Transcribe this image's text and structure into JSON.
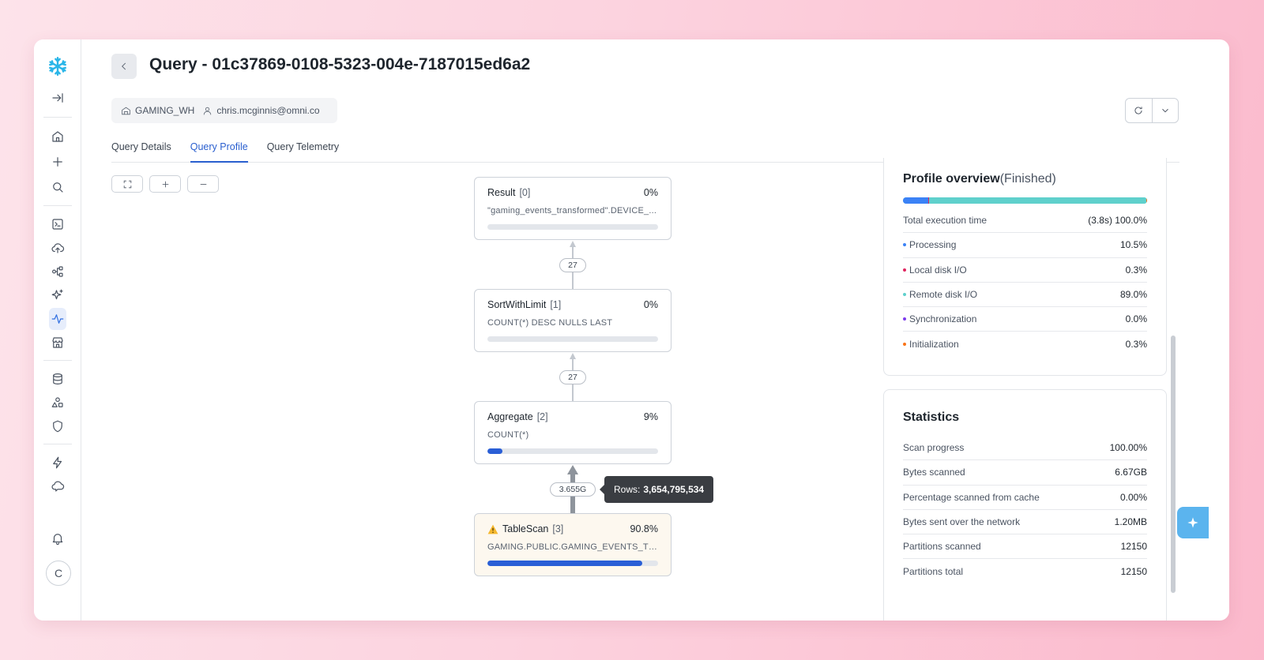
{
  "header": {
    "title": "Query - 01c37869-0108-5323-004e-7187015ed6a2",
    "warehouse": "GAMING_WH",
    "user": "chris.mcginnis@omni.co"
  },
  "tabs": [
    {
      "label": "Query Details",
      "active": false
    },
    {
      "label": "Query Profile",
      "active": true
    },
    {
      "label": "Query Telemetry",
      "active": false
    }
  ],
  "graph": {
    "nodes": [
      {
        "name": "Result",
        "index": "[0]",
        "percent": "0%",
        "detail": "\"gaming_events_transformed\".DEVICE_...",
        "bar_fraction": 0
      },
      {
        "name": "SortWithLimit",
        "index": "[1]",
        "percent": "0%",
        "detail": "COUNT(*) DESC NULLS LAST",
        "bar_fraction": 0
      },
      {
        "name": "Aggregate",
        "index": "[2]",
        "percent": "9%",
        "detail": "COUNT(*)",
        "bar_fraction": 0.09
      },
      {
        "name": "TableScan",
        "index": "[3]",
        "percent": "90.8%",
        "detail": "GAMING.PUBLIC.GAMING_EVENTS_TRA...",
        "bar_fraction": 0.908
      }
    ],
    "edges": [
      "27",
      "27",
      "3.655G"
    ],
    "tooltip": {
      "label": "Rows:",
      "value": "3,654,795,534"
    }
  },
  "profile_overview": {
    "title": "Profile overview",
    "status": "(Finished)",
    "total_label": "Total execution time",
    "total_value": "(3.8s) 100.0%",
    "items": [
      {
        "label": "Processing",
        "value": "10.5%",
        "color": "#3b82f6",
        "fraction": 0.105
      },
      {
        "label": "Local disk I/O",
        "value": "0.3%",
        "color": "#e0245e",
        "fraction": 0.003
      },
      {
        "label": "Remote disk I/O",
        "value": "89.0%",
        "color": "#5fd0cc",
        "fraction": 0.89
      },
      {
        "label": "Synchronization",
        "value": "0.0%",
        "color": "#7c3aed",
        "fraction": 0.0
      },
      {
        "label": "Initialization",
        "value": "0.3%",
        "color": "#f97316",
        "fraction": 0.003
      }
    ]
  },
  "statistics": {
    "title": "Statistics",
    "items": [
      {
        "label": "Scan progress",
        "value": "100.00%"
      },
      {
        "label": "Bytes scanned",
        "value": "6.67GB"
      },
      {
        "label": "Percentage scanned from cache",
        "value": "0.00%"
      },
      {
        "label": "Bytes sent over the network",
        "value": "1.20MB"
      },
      {
        "label": "Partitions scanned",
        "value": "12150"
      },
      {
        "label": "Partitions total",
        "value": "12150"
      }
    ]
  },
  "user_initial": "C",
  "icons": {
    "sidebar": [
      "snowflake-logo",
      "collapse-sidebar-icon",
      "home-icon",
      "plus-icon",
      "search-icon",
      "terminal-icon",
      "cloud-upload-icon",
      "data-flow-icon",
      "sparkles-icon",
      "activity-icon",
      "marketplace-icon",
      "database-icon",
      "shapes-icon",
      "shield-icon",
      "bolt-icon",
      "cloud-chat-icon",
      "bell-icon"
    ]
  }
}
